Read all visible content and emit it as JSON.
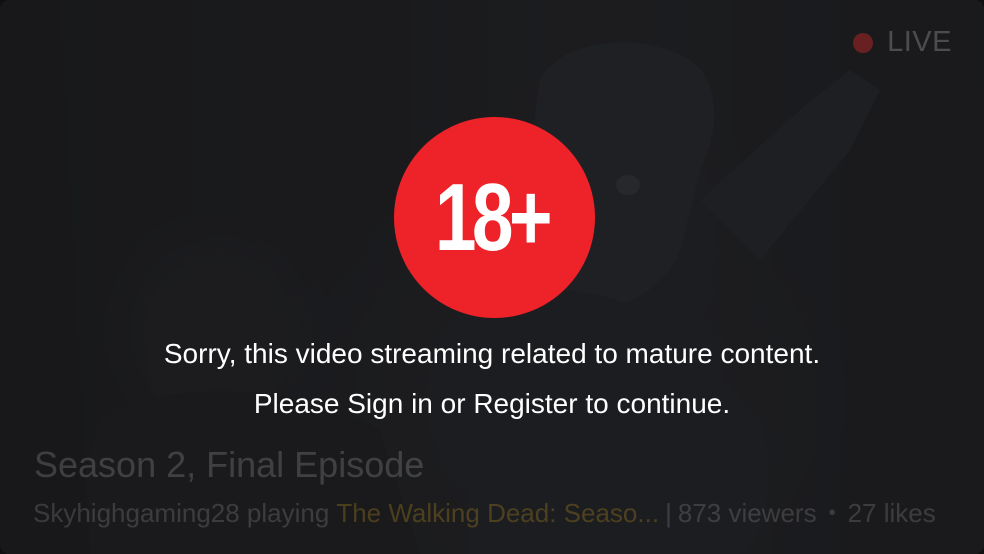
{
  "live_badge": {
    "label": "LIVE",
    "dot_color": "#c82828"
  },
  "age_badge": {
    "text": "18+",
    "color": "#ee2229"
  },
  "message": {
    "line1": "Sorry, this video streaming related to mature content.",
    "line2": "Please Sign in or Register to continue."
  },
  "stream": {
    "title": "Season 2, Final Episode",
    "streamer": "Skyhighgaming28 playing",
    "game": "The Walking Dead: Seaso...",
    "separator": "|",
    "viewers": "873 viewers",
    "bullet": "•",
    "likes": "27 likes"
  }
}
